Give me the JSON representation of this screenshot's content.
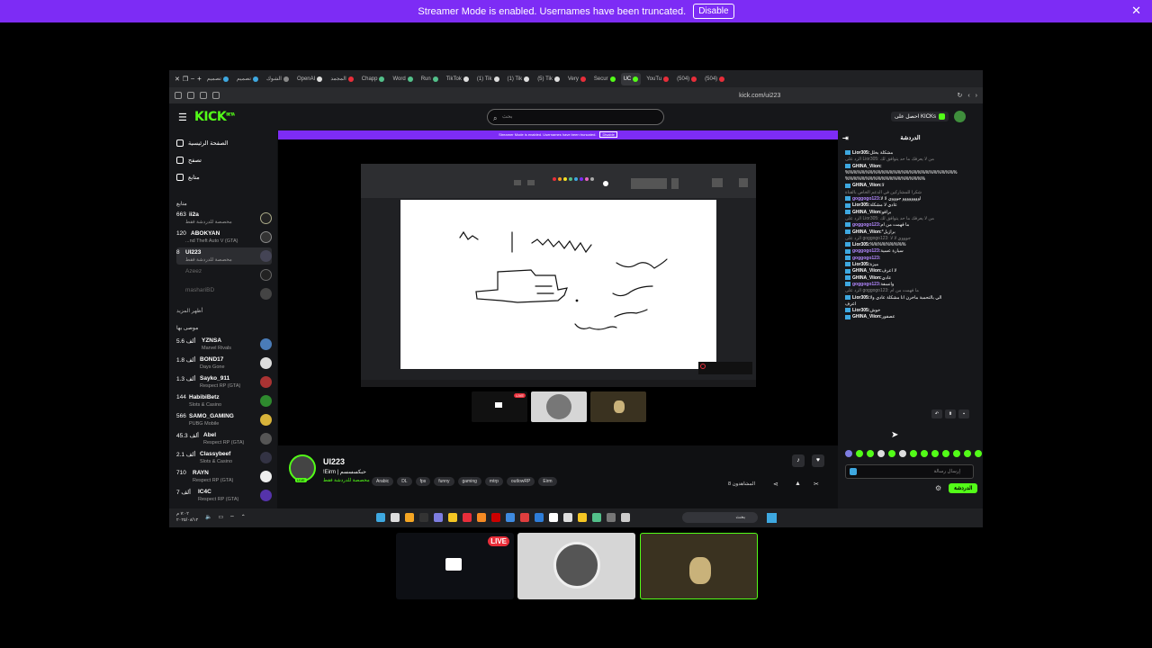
{
  "banner": {
    "text": "Streamer Mode is enabled. Usernames have been truncated.",
    "disable": "Disable",
    "close": "✕"
  },
  "browser": {
    "tabs": [
      "تصميم",
      "تصميم",
      "الشوك",
      "OpenAI",
      "المجمد",
      "Chapp",
      "Word",
      "Run",
      "TikTok",
      "(1) Tik",
      "(1) Tik",
      "(5) Tik",
      "Very",
      "Secur",
      "UC",
      "YouTu",
      "(504)",
      "(504)"
    ],
    "url": "kick.com/ui223"
  },
  "kick": {
    "logo": "KICK",
    "logo_sup": "BETA",
    "search_placeholder": "بحث",
    "get_kicks": "احصل على KICKs",
    "nav": {
      "home": "الصفحة الرئيسية",
      "browse": "تصفح",
      "following": "متابع"
    },
    "following_title": "متابع",
    "following": [
      {
        "count": "663",
        "name": "ii2a",
        "game": "مخصصة للدردشة فقط"
      },
      {
        "count": "120",
        "name": "ABOKYAN",
        "game": "...nd Theft Auto V (GTA)"
      },
      {
        "count": "8",
        "name": "UI223",
        "game": "مخصصة للدردشة فقط"
      },
      {
        "count": "",
        "name": "Azeez",
        "game": ""
      },
      {
        "count": "",
        "name": "mashariBD",
        "game": ""
      }
    ],
    "show_more": "أظهر المزيد",
    "recommended_title": "موصى بها",
    "recommended": [
      {
        "count": "5.6 ألف",
        "name": "YZNSA",
        "game": "Marvel Rivals"
      },
      {
        "count": "1.8 ألف",
        "name": "BOND17",
        "game": "Days Gone"
      },
      {
        "count": "1.3 ألف",
        "name": "Sayko_911",
        "game": "Respect RP (GTA)"
      },
      {
        "count": "144",
        "name": "HabibiBetz",
        "game": "Slots & Casino"
      },
      {
        "count": "566",
        "name": "SAMO_GAMING",
        "game": "PUBG Mobile"
      },
      {
        "count": "45.3 ألف",
        "name": "Abel",
        "game": "Respect RP (GTA)"
      },
      {
        "count": "2.1 ألف",
        "name": "Classybeef",
        "game": "Slots & Casino"
      },
      {
        "count": "710",
        "name": "RAYN",
        "game": "Respect RP (GTA)"
      },
      {
        "count": "7 ألف",
        "name": "IC4C",
        "game": "Respect RP (GTA)"
      }
    ],
    "inner_banner": "Streamer Mode is enabled. Usernames have been truncated.",
    "inner_disable": "Disable",
    "stream": {
      "name": "UI223",
      "title": "!Eirm | حبكسسسم",
      "category": "مخصصة للدردشة فقط",
      "live": "LIVE",
      "tags": [
        "Arabic",
        "DL",
        "fps",
        "funny",
        "gaming",
        "mtrp",
        "outlowRP",
        "Eirm"
      ],
      "viewers": "8 المشاهدون"
    },
    "chat": {
      "title": "الدردشة",
      "messages": [
        {
          "user": "Lior305:",
          "text": "مشكلة بخلل",
          "reply": false
        },
        {
          "user": "",
          "text": "الرد على Lior305: من لا يعرفك ما حد يتوافق لك",
          "reply": true
        },
        {
          "user": "GHINA_Viion:",
          "text": "",
          "reply": false
        },
        {
          "user": "",
          "text": "%%%%%%%%%%%%%%%%%%%%%%%%%%%%",
          "reply": false
        },
        {
          "user": "",
          "text": "%%%%%%%%%%%%%%%%%%%%",
          "reply": false
        },
        {
          "user": "GHINA_Viion:",
          "text": "لا",
          "reply": false
        },
        {
          "user": "",
          "text": "شكرا للمشاركين في الدعم الخاص بالقناة",
          "reply": true
        },
        {
          "user": "goggogo123:",
          "text": "اوووووووو جوووي لا لا",
          "reply": false
        },
        {
          "user": "Lior305:",
          "text": "عادي لا مشكلة",
          "reply": false
        },
        {
          "user": "GHINA_Viion:",
          "text": "برافو",
          "reply": false
        },
        {
          "user": "",
          "text": "الرد على Lior305: من لا يعرفك ما حد يتوافق لك",
          "reply": true
        },
        {
          "user": "goggogo123:",
          "text": "ما فهمت من ام",
          "reply": false
        },
        {
          "user": "GHINA_Viion:",
          "text": "*برازيل",
          "reply": false
        },
        {
          "user": "",
          "text": "الرد على goggogo123: جوووي لا لا",
          "reply": true
        },
        {
          "user": "Lior305:",
          "text": "%%%%%%%%%",
          "reply": false
        },
        {
          "user": "goggogo123:",
          "text": "سيارة عسية",
          "reply": false
        },
        {
          "user": "goggogo123:",
          "text": "",
          "reply": false
        },
        {
          "user": "Lior305:",
          "text": "ميزة",
          "reply": false
        },
        {
          "user": "GHINA_Viion:",
          "text": "لا اعرف",
          "reply": false
        },
        {
          "user": "GHINA_Viion:",
          "text": "عادي",
          "reply": false
        },
        {
          "user": "goggogo123:",
          "text": "وانسفة",
          "reply": false
        },
        {
          "user": "",
          "text": "الرد على goggogo123: ما فهمت من ام",
          "reply": true
        },
        {
          "user": "Lior305:",
          "text": "الي بالتحمبة ماخرن انا مشكلة عادي ولا",
          "reply": false
        },
        {
          "user": "",
          "text": "اعرف",
          "reply": false
        },
        {
          "user": "Lior305:",
          "text": "خوش",
          "reply": false
        },
        {
          "user": "GHINA_Viion:",
          "text": "عصفور",
          "reply": false
        }
      ],
      "input_placeholder": "إرسال رسالة",
      "send": "الدردشة"
    }
  },
  "taskbar": {
    "date": "٢٠٢٥/٠٨/١٢",
    "time": "٧:٠٢ م",
    "search": "بحث"
  },
  "cams": {
    "live": "LIVE"
  },
  "icons": [
    "close-icon",
    "search-icon",
    "home-icon",
    "compass-icon",
    "heart-icon",
    "gear-icon",
    "bell-icon",
    "share-icon",
    "windows-icon"
  ]
}
